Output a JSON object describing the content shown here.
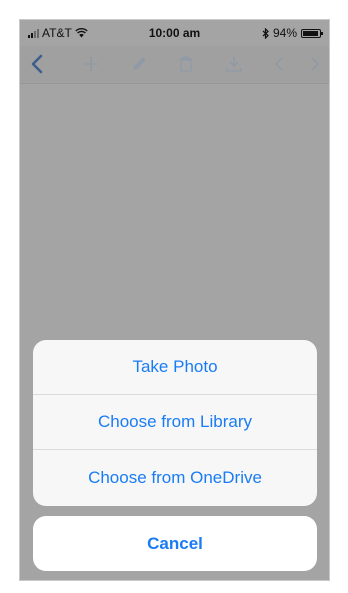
{
  "status_bar": {
    "carrier": "AT&T",
    "time": "10:00 am",
    "battery_percent": "94%",
    "battery_level": 0.94
  },
  "toolbar": {
    "icons": [
      "back-icon",
      "add-icon",
      "edit-icon",
      "delete-icon",
      "download-icon",
      "previous-icon",
      "next-icon"
    ]
  },
  "action_sheet": {
    "actions": [
      {
        "label": "Take Photo"
      },
      {
        "label": "Choose from Library"
      },
      {
        "label": "Choose from OneDrive"
      }
    ],
    "cancel_label": "Cancel"
  },
  "colors": {
    "accent": "#1a7cf5",
    "dimmed_background": "#a4a4a4",
    "sheet_background": "#f7f7f7"
  }
}
